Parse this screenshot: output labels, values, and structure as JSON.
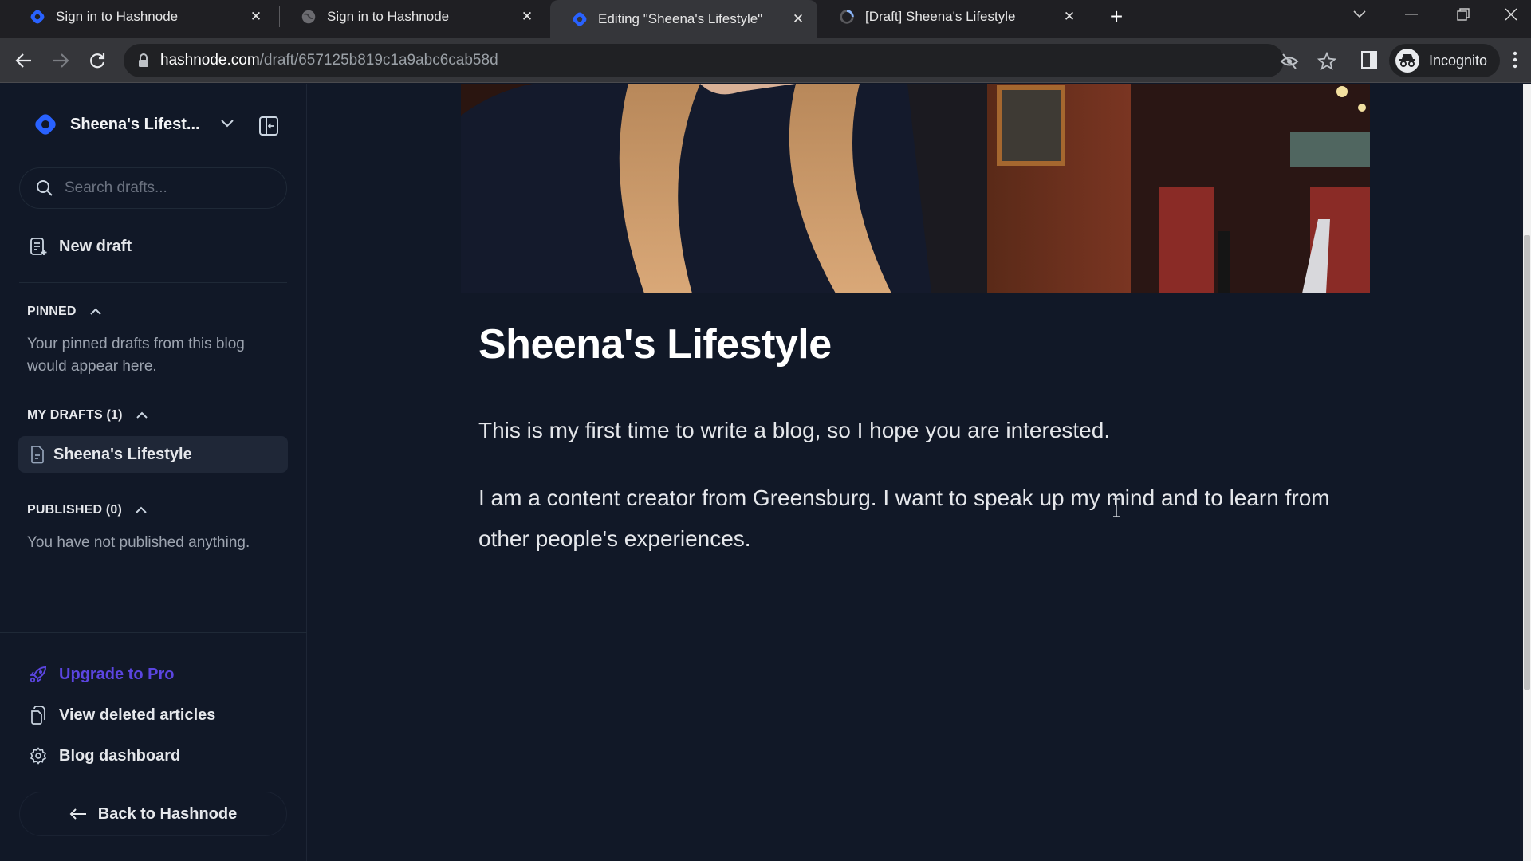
{
  "browser": {
    "tabs": [
      {
        "label": "Sign in to Hashnode",
        "favicon": "hashnode-logo-icon",
        "active": false
      },
      {
        "label": "Sign in to Hashnode",
        "favicon": "globe-icon",
        "active": false
      },
      {
        "label": "Editing \"Sheena's Lifestyle\"",
        "favicon": "hashnode-logo-icon",
        "active": true
      },
      {
        "label": "[Draft] Sheena's Lifestyle",
        "favicon": "loading-icon",
        "active": false
      }
    ],
    "url_host": "hashnode.com",
    "url_path": "/draft/657125b819c1a9abc6cab58d",
    "profile_label": "Incognito"
  },
  "sidebar": {
    "blog_name": "Sheena's Lifest...",
    "search_placeholder": "Search drafts...",
    "new_draft_label": "New draft",
    "pinned": {
      "heading": "PINNED",
      "empty_text": "Your pinned drafts from this blog would appear here."
    },
    "my_drafts": {
      "heading": "MY DRAFTS (1)",
      "items": [
        {
          "label": "Sheena's Lifestyle"
        }
      ]
    },
    "published": {
      "heading": "PUBLISHED (0)",
      "empty_text": "You have not published anything."
    },
    "footer": {
      "upgrade_label": "Upgrade to Pro",
      "deleted_label": "View deleted articles",
      "dashboard_label": "Blog dashboard",
      "back_label": "Back to Hashnode"
    }
  },
  "editor": {
    "title": "Sheena's Lifestyle",
    "paragraphs": [
      "This is my first time to write a blog, so I hope you are interested.",
      "I am a content creator from Greensburg. I want to speak up my mind and to learn from other people's experiences."
    ]
  },
  "colors": {
    "brand": "#2962ff",
    "upgrade": "#5b45e0",
    "background": "#111827"
  }
}
